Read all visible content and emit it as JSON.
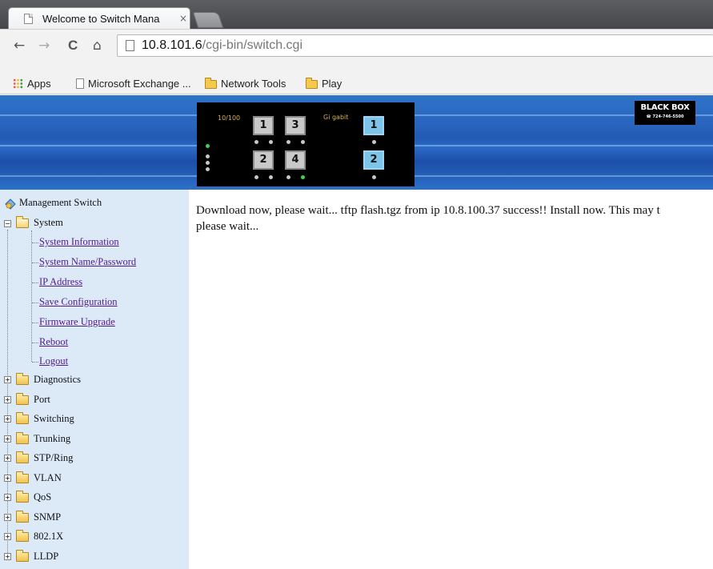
{
  "browser": {
    "tab_title": "Welcome to Switch Mana",
    "tab_close": "×",
    "url_host": "10.8.101.6",
    "url_path": "/cgi-bin/switch.cgi",
    "back": "←",
    "forward": "→",
    "reload": "C",
    "home": "⌂",
    "bookmarks": [
      {
        "label": "Apps",
        "icon": "apps-grid-icon"
      },
      {
        "label": "Microsoft Exchange ...",
        "icon": "page-icon"
      },
      {
        "label": "Network Tools",
        "icon": "folder-icon"
      },
      {
        "label": "Play",
        "icon": "folder-icon"
      }
    ]
  },
  "header": {
    "panel_label_left": "10/100",
    "panel_label_right": "Gi gabit",
    "ports_10_100": [
      "1",
      "3",
      "2",
      "4"
    ],
    "ports_gigabit": [
      "1",
      "2"
    ],
    "logo_text": "BLACK BOX",
    "logo_phone": "☎ 724-746-5500",
    "colors": {
      "banner": "#2a66bf",
      "sidebar": "#dce9f7",
      "port": "#c9c9c9",
      "giga_port": "#7ec4e8",
      "led_active": "#41d14a"
    }
  },
  "sidebar": {
    "root": "Management Switch",
    "system": "System",
    "system_links": [
      "System Information",
      "System Name/Password",
      "IP Address",
      "Save Configuration",
      "Firmware Upgrade",
      "Reboot",
      "Logout"
    ],
    "folders": [
      "Diagnostics",
      "Port",
      "Switching",
      "Trunking",
      "STP/Ring",
      "VLAN",
      "QoS",
      "SNMP",
      "802.1X",
      "LLDP"
    ],
    "expand": "+",
    "collapse": "−"
  },
  "main": {
    "line1": "Download now, please wait... tftp flash.tgz from ip 10.8.100.37 success!! Install now. This may t",
    "line2": "please wait..."
  }
}
